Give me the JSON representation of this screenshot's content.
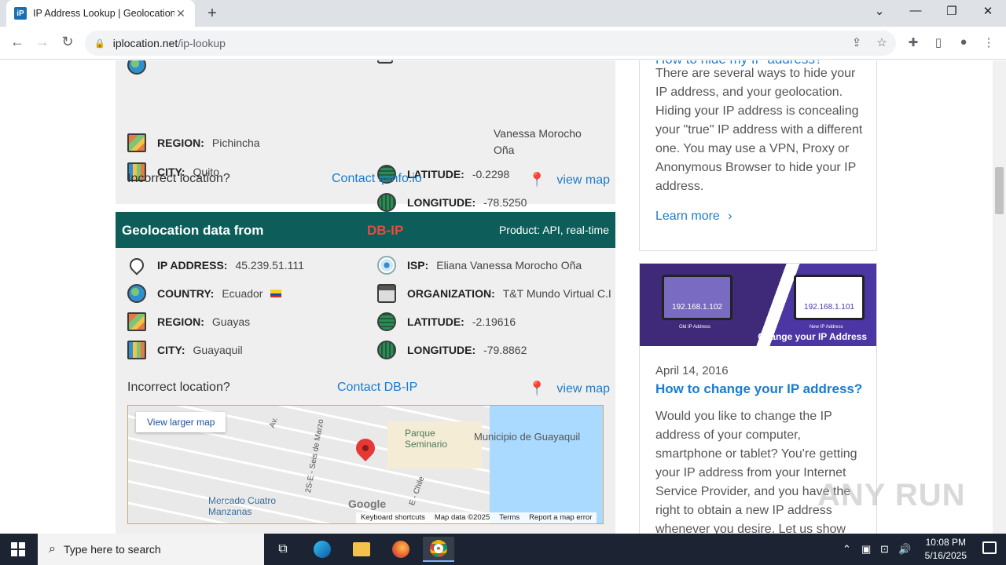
{
  "browser": {
    "tab_title": "IP Address Lookup | Geolocation",
    "tab_favicon": "iP",
    "url_host": "iplocation.net",
    "url_path": "/ip-lookup"
  },
  "card1": {
    "partial_value": "Vanessa Morocho Oña",
    "region_label": "REGION:",
    "region_value": "Pichincha",
    "city_label": "CITY:",
    "city_value": "Quito",
    "lat_label": "LATITUDE:",
    "lat_value": "-0.2298",
    "lon_label": "LONGITUDE:",
    "lon_value": "-78.5250",
    "incorrect": "Incorrect location?",
    "contact": "Contact ipinfo.io",
    "viewmap": "view map"
  },
  "card2": {
    "header_title": "Geolocation data from",
    "header_provider": "DB-IP",
    "header_product": "Product: API, real-time",
    "ip_label": "IP ADDRESS:",
    "ip_value": "45.239.51.111",
    "country_label": "COUNTRY:",
    "country_value": "Ecuador",
    "region_label": "REGION:",
    "region_value": "Guayas",
    "city_label": "CITY:",
    "city_value": "Guayaquil",
    "isp_label": "ISP:",
    "isp_value": "Eliana Vanessa Morocho Oña",
    "org_label": "ORGANIZATION:",
    "org_value": "T&T Mundo Virtual C.I",
    "lat_label": "LATITUDE:",
    "lat_value": "-2.19616",
    "lon_label": "LONGITUDE:",
    "lon_value": "-79.8862",
    "incorrect": "Incorrect location?",
    "contact": "Contact DB-IP",
    "viewmap": "view map"
  },
  "map": {
    "view_larger": "View larger map",
    "park": "Parque Seminario",
    "municipio": "Municipio de Guayaquil",
    "mercado": "Mercado Cuatro Manzanas",
    "road1": "2S-E - Seis de Marzo",
    "road2": "E - Chile",
    "road3": "Av.",
    "google": "Google",
    "keyboard": "Keyboard shortcuts",
    "mapdata": "Map data ©2025",
    "terms": "Terms",
    "report": "Report a map error"
  },
  "sidebar": {
    "hide_title": "How to hide my IP address?",
    "hide_text": "There are several ways to hide your IP address, and your geolocation. Hiding your IP address is concealing your \"true\" IP address with a different one. You may use a VPN, Proxy or Anonymous Browser to hide your IP address.",
    "learn_more": "Learn more",
    "banner_old_ip": "192.168.1.102",
    "banner_new_ip": "192.168.1.101",
    "banner_old_label": "Old IP Address",
    "banner_new_label": "New IP Address",
    "banner_caption": "Change your IP Address",
    "date": "April 14, 2016",
    "change_title": "How to change your IP address?",
    "change_text": "Would you like to change the IP address of your computer, smartphone or tablet? You're getting your IP address from your Internet Service Provider, and you have the right to obtain a new IP address whenever you desire. Let us show you"
  },
  "watermark": "ANY RUN",
  "taskbar": {
    "search_placeholder": "Type here to search",
    "time": "10:08 PM",
    "date": "5/16/2025"
  }
}
